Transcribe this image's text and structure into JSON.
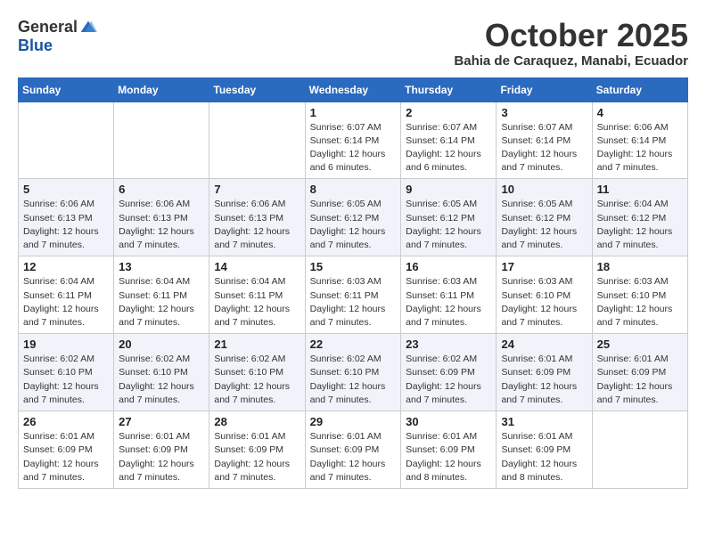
{
  "header": {
    "logo_general": "General",
    "logo_blue": "Blue",
    "month_title": "October 2025",
    "subtitle": "Bahia de Caraquez, Manabi, Ecuador"
  },
  "days_of_week": [
    "Sunday",
    "Monday",
    "Tuesday",
    "Wednesday",
    "Thursday",
    "Friday",
    "Saturday"
  ],
  "weeks": [
    [
      {
        "day": "",
        "detail": ""
      },
      {
        "day": "",
        "detail": ""
      },
      {
        "day": "",
        "detail": ""
      },
      {
        "day": "1",
        "detail": "Sunrise: 6:07 AM\nSunset: 6:14 PM\nDaylight: 12 hours\nand 6 minutes."
      },
      {
        "day": "2",
        "detail": "Sunrise: 6:07 AM\nSunset: 6:14 PM\nDaylight: 12 hours\nand 6 minutes."
      },
      {
        "day": "3",
        "detail": "Sunrise: 6:07 AM\nSunset: 6:14 PM\nDaylight: 12 hours\nand 7 minutes."
      },
      {
        "day": "4",
        "detail": "Sunrise: 6:06 AM\nSunset: 6:14 PM\nDaylight: 12 hours\nand 7 minutes."
      }
    ],
    [
      {
        "day": "5",
        "detail": "Sunrise: 6:06 AM\nSunset: 6:13 PM\nDaylight: 12 hours\nand 7 minutes."
      },
      {
        "day": "6",
        "detail": "Sunrise: 6:06 AM\nSunset: 6:13 PM\nDaylight: 12 hours\nand 7 minutes."
      },
      {
        "day": "7",
        "detail": "Sunrise: 6:06 AM\nSunset: 6:13 PM\nDaylight: 12 hours\nand 7 minutes."
      },
      {
        "day": "8",
        "detail": "Sunrise: 6:05 AM\nSunset: 6:12 PM\nDaylight: 12 hours\nand 7 minutes."
      },
      {
        "day": "9",
        "detail": "Sunrise: 6:05 AM\nSunset: 6:12 PM\nDaylight: 12 hours\nand 7 minutes."
      },
      {
        "day": "10",
        "detail": "Sunrise: 6:05 AM\nSunset: 6:12 PM\nDaylight: 12 hours\nand 7 minutes."
      },
      {
        "day": "11",
        "detail": "Sunrise: 6:04 AM\nSunset: 6:12 PM\nDaylight: 12 hours\nand 7 minutes."
      }
    ],
    [
      {
        "day": "12",
        "detail": "Sunrise: 6:04 AM\nSunset: 6:11 PM\nDaylight: 12 hours\nand 7 minutes."
      },
      {
        "day": "13",
        "detail": "Sunrise: 6:04 AM\nSunset: 6:11 PM\nDaylight: 12 hours\nand 7 minutes."
      },
      {
        "day": "14",
        "detail": "Sunrise: 6:04 AM\nSunset: 6:11 PM\nDaylight: 12 hours\nand 7 minutes."
      },
      {
        "day": "15",
        "detail": "Sunrise: 6:03 AM\nSunset: 6:11 PM\nDaylight: 12 hours\nand 7 minutes."
      },
      {
        "day": "16",
        "detail": "Sunrise: 6:03 AM\nSunset: 6:11 PM\nDaylight: 12 hours\nand 7 minutes."
      },
      {
        "day": "17",
        "detail": "Sunrise: 6:03 AM\nSunset: 6:10 PM\nDaylight: 12 hours\nand 7 minutes."
      },
      {
        "day": "18",
        "detail": "Sunrise: 6:03 AM\nSunset: 6:10 PM\nDaylight: 12 hours\nand 7 minutes."
      }
    ],
    [
      {
        "day": "19",
        "detail": "Sunrise: 6:02 AM\nSunset: 6:10 PM\nDaylight: 12 hours\nand 7 minutes."
      },
      {
        "day": "20",
        "detail": "Sunrise: 6:02 AM\nSunset: 6:10 PM\nDaylight: 12 hours\nand 7 minutes."
      },
      {
        "day": "21",
        "detail": "Sunrise: 6:02 AM\nSunset: 6:10 PM\nDaylight: 12 hours\nand 7 minutes."
      },
      {
        "day": "22",
        "detail": "Sunrise: 6:02 AM\nSunset: 6:10 PM\nDaylight: 12 hours\nand 7 minutes."
      },
      {
        "day": "23",
        "detail": "Sunrise: 6:02 AM\nSunset: 6:09 PM\nDaylight: 12 hours\nand 7 minutes."
      },
      {
        "day": "24",
        "detail": "Sunrise: 6:01 AM\nSunset: 6:09 PM\nDaylight: 12 hours\nand 7 minutes."
      },
      {
        "day": "25",
        "detail": "Sunrise: 6:01 AM\nSunset: 6:09 PM\nDaylight: 12 hours\nand 7 minutes."
      }
    ],
    [
      {
        "day": "26",
        "detail": "Sunrise: 6:01 AM\nSunset: 6:09 PM\nDaylight: 12 hours\nand 7 minutes."
      },
      {
        "day": "27",
        "detail": "Sunrise: 6:01 AM\nSunset: 6:09 PM\nDaylight: 12 hours\nand 7 minutes."
      },
      {
        "day": "28",
        "detail": "Sunrise: 6:01 AM\nSunset: 6:09 PM\nDaylight: 12 hours\nand 7 minutes."
      },
      {
        "day": "29",
        "detail": "Sunrise: 6:01 AM\nSunset: 6:09 PM\nDaylight: 12 hours\nand 7 minutes."
      },
      {
        "day": "30",
        "detail": "Sunrise: 6:01 AM\nSunset: 6:09 PM\nDaylight: 12 hours\nand 8 minutes."
      },
      {
        "day": "31",
        "detail": "Sunrise: 6:01 AM\nSunset: 6:09 PM\nDaylight: 12 hours\nand 8 minutes."
      },
      {
        "day": "",
        "detail": ""
      }
    ]
  ]
}
